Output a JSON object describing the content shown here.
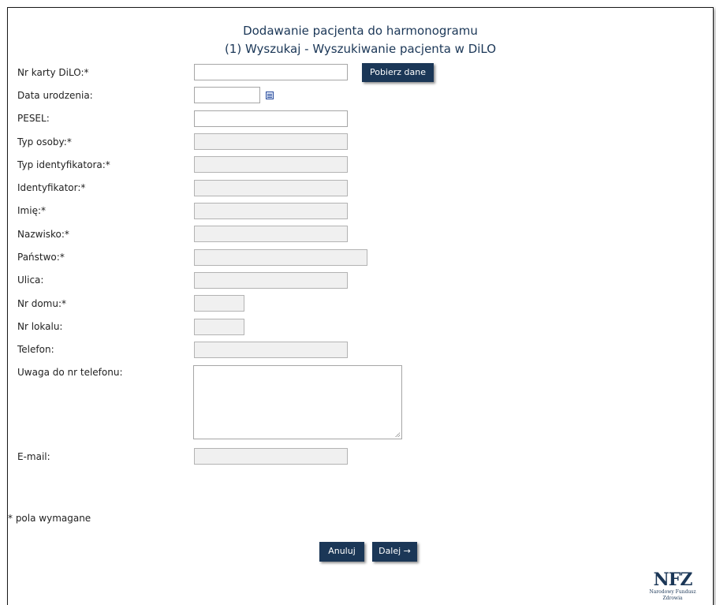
{
  "header": {
    "title": "Dodawanie pacjenta do harmonogramu",
    "subtitle": "(1) Wyszukaj - Wyszukiwanie pacjenta w DiLO"
  },
  "form": {
    "nr_karty_label": "Nr karty DiLO:*",
    "fetch_button": "Pobierz dane",
    "data_urodzenia_label": "Data urodzenia:",
    "pesel_label": "PESEL:",
    "typ_osoby_label": "Typ osoby:*",
    "typ_identyfikatora_label": "Typ identyfikatora:*",
    "identyfikator_label": "Identyfikator:*",
    "imie_label": "Imię:*",
    "nazwisko_label": "Nazwisko:*",
    "panstwo_label": "Państwo:*",
    "ulica_label": "Ulica:",
    "nr_domu_label": "Nr domu:*",
    "nr_lokalu_label": "Nr lokalu:",
    "telefon_label": "Telefon:",
    "uwaga_label": "Uwaga do nr telefonu:",
    "email_label": "E-mail:"
  },
  "footer": {
    "required_note": "* pola wymagane",
    "cancel_button": "Anuluj",
    "next_button": "Dalej →",
    "logo_text": "NFZ",
    "logo_subtext": "Narodowy Fundusz Zdrowia"
  }
}
